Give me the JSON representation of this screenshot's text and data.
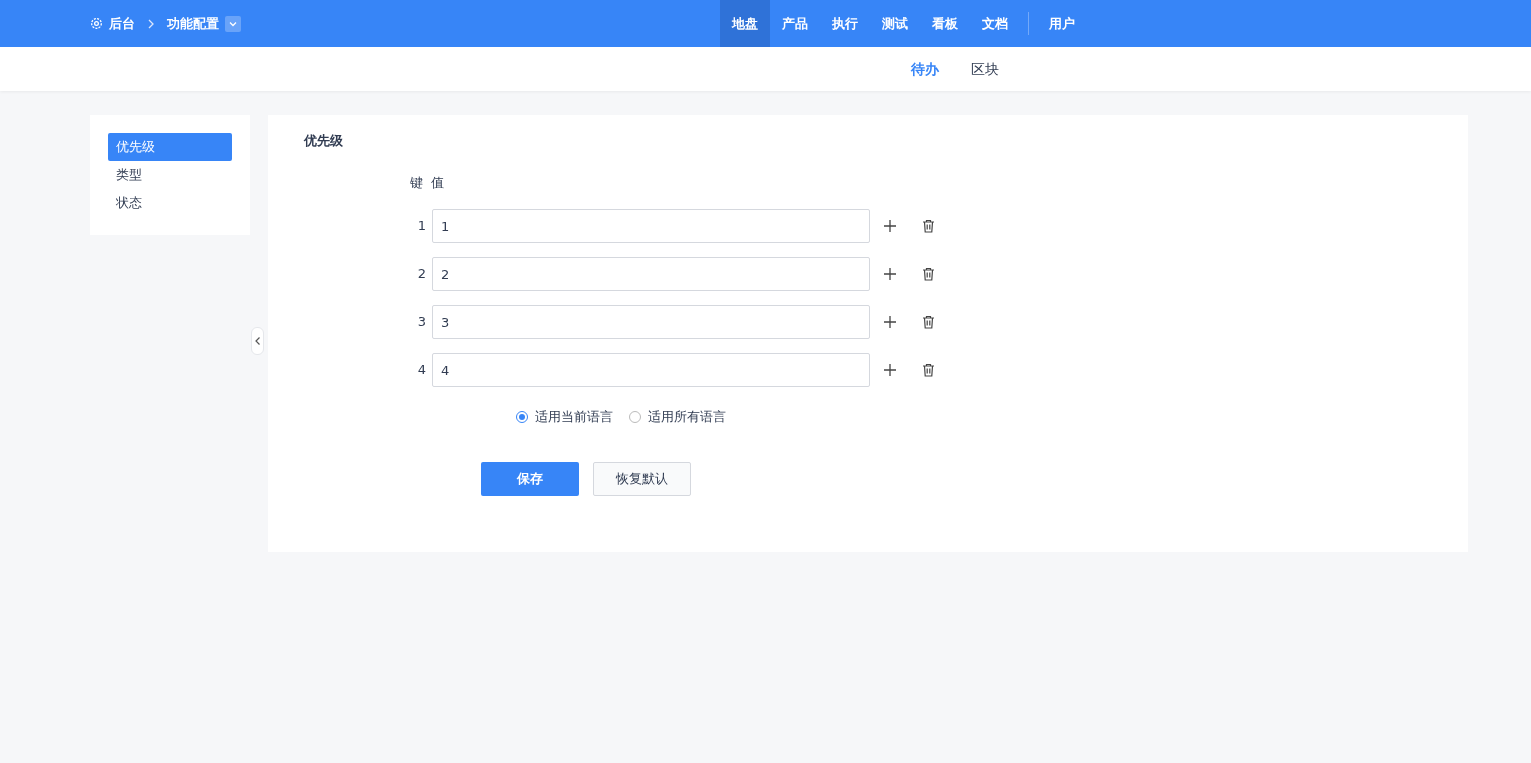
{
  "breadcrumb": {
    "root": "后台",
    "current": "功能配置"
  },
  "nav": [
    {
      "label": "地盘",
      "selected": true
    },
    {
      "label": "产品",
      "selected": false
    },
    {
      "label": "执行",
      "selected": false
    },
    {
      "label": "测试",
      "selected": false
    },
    {
      "label": "看板",
      "selected": false
    },
    {
      "label": "文档",
      "selected": false
    }
  ],
  "nav_extra": [
    {
      "label": "用户",
      "selected": false
    }
  ],
  "subnav": [
    {
      "label": "待办",
      "selected": true
    },
    {
      "label": "区块",
      "selected": false
    }
  ],
  "sidebar": {
    "items": [
      {
        "label": "优先级",
        "selected": true
      },
      {
        "label": "类型",
        "selected": false
      },
      {
        "label": "状态",
        "selected": false
      }
    ]
  },
  "form": {
    "title": "优先级",
    "key_header": "键",
    "value_header": "值",
    "rows": [
      {
        "key": "1",
        "value": "1"
      },
      {
        "key": "2",
        "value": "2"
      },
      {
        "key": "3",
        "value": "3"
      },
      {
        "key": "4",
        "value": "4"
      }
    ],
    "scope": [
      {
        "label": "适用当前语言",
        "selected": true
      },
      {
        "label": "适用所有语言",
        "selected": false
      }
    ],
    "save": "保存",
    "reset": "恢复默认"
  }
}
